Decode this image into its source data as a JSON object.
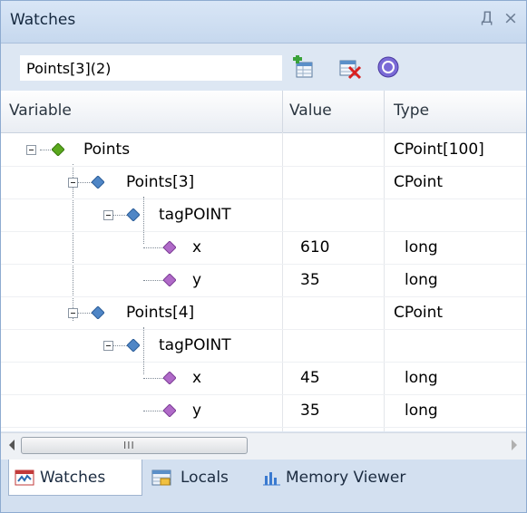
{
  "window": {
    "title": "Watches",
    "pin_glyph": "Д",
    "close_glyph": "×"
  },
  "toolbar": {
    "expression_value": "Points[3](2)",
    "add_watch_icon": "add-watch-icon",
    "delete_watch_icon": "delete-watch-icon",
    "help_icon": "help-icon"
  },
  "columns": {
    "variable": "Variable",
    "value": "Value",
    "type": "Type"
  },
  "rows": [
    {
      "variable": "Points",
      "value": "",
      "type": "CPoint[100]",
      "icon": "green-diamond-icon"
    },
    {
      "variable": "Points[3]",
      "value": "",
      "type": "CPoint",
      "icon": "blue-diamond-icon"
    },
    {
      "variable": "tagPOINT",
      "value": "",
      "type": "",
      "icon": "blue-diamond-icon"
    },
    {
      "variable": "x",
      "value": "610",
      "type": "long",
      "icon": "purple-diamond-icon"
    },
    {
      "variable": "y",
      "value": "35",
      "type": "long",
      "icon": "purple-diamond-icon"
    },
    {
      "variable": "Points[4]",
      "value": "",
      "type": "CPoint",
      "icon": "blue-diamond-icon"
    },
    {
      "variable": "tagPOINT",
      "value": "",
      "type": "",
      "icon": "blue-diamond-icon"
    },
    {
      "variable": "x",
      "value": "45",
      "type": "long",
      "icon": "purple-diamond-icon"
    },
    {
      "variable": "y",
      "value": "35",
      "type": "long",
      "icon": "purple-diamond-icon"
    }
  ],
  "scrollbar": {
    "grip": "III"
  },
  "tabs": [
    {
      "label": "Watches",
      "active": true,
      "icon": "watches-icon"
    },
    {
      "label": "Locals",
      "active": false,
      "icon": "locals-icon"
    },
    {
      "label": "Memory Viewer",
      "active": false,
      "icon": "memory-viewer-icon"
    }
  ],
  "colors": {
    "green_diamond": "#5aa81e",
    "blue_diamond": "#4f86c6",
    "purple_diamond": "#b06ac8",
    "title_bar": "#c6d8ee",
    "tab_bar": "#d3e0f0"
  }
}
